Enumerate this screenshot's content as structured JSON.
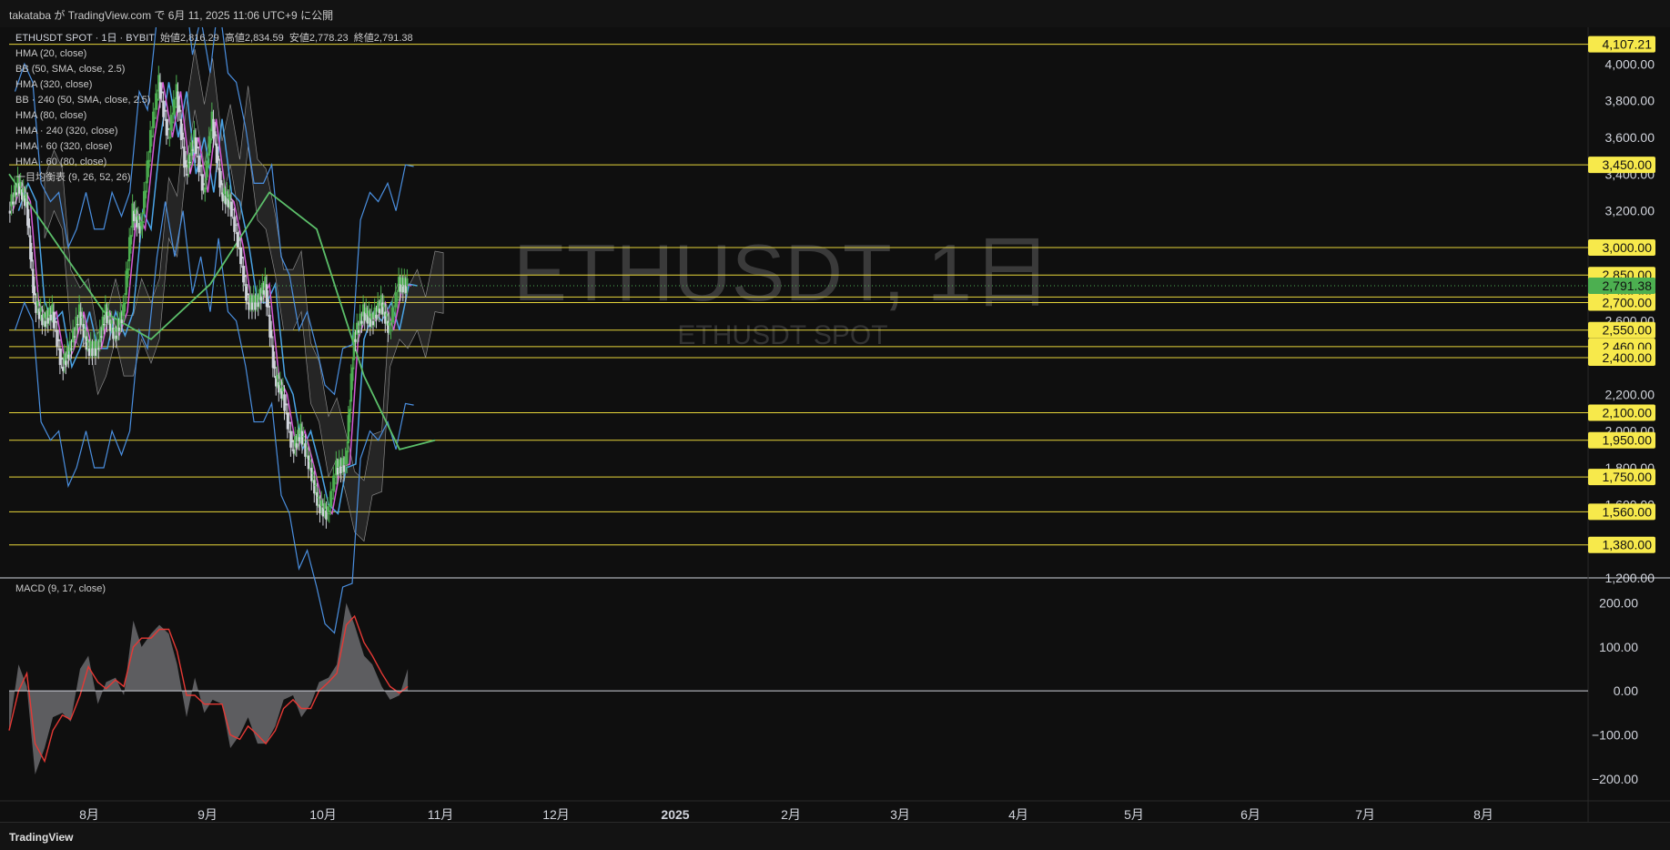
{
  "header": {
    "published": "takataba が TradingView.com で 6月 11, 2025 11:06 UTC+9 に公開"
  },
  "symbol": {
    "title": "ETHUSDT SPOT · 1日 · BYBIT",
    "open_label": "始値",
    "open": "2,816.29",
    "high_label": "高値",
    "high": "2,834.59",
    "low_label": "安値",
    "low": "2,778.23",
    "close_label": "終値",
    "close": "2,791.38"
  },
  "indicators": [
    "HMA (20, close)",
    "BB (50, SMA, close, 2.5)",
    "HMA (320, close)",
    "BB · 240 (50, SMA, close, 2.5)",
    "HMA (80, close)",
    "HMA · 240 (320, close)",
    "HMA · 60 (320, close)",
    "HMA · 60 (80, close)",
    "一目均衡表 (9, 26, 52, 26)"
  ],
  "watermark": {
    "main": "ETHUSDT, 1日",
    "sub": "ETHUSDT SPOT"
  },
  "macd_label": "MACD (9, 17, close)",
  "footer": {
    "brand": "TradingView"
  },
  "colors": {
    "background": "#0f0f0f",
    "candle_up": "#4caf50",
    "candle_down": "#d1d4dc",
    "hline": "#e7d63a",
    "tag_bg": "#f7e94b",
    "current_tag_bg": "#4caf50",
    "bb": "#4a8fe0",
    "hma20": "#d75bd8",
    "hma_blue": "#4aa3e6",
    "hma_green": "#5cbf6a",
    "macd_line": "#e53935",
    "macd_area": "#6b6b6e"
  },
  "chart_data": [
    {
      "type": "line",
      "title": "ETHUSDT SPOT · 1日 · BYBIT",
      "ylim": [
        1200,
        4150
      ],
      "y_ticks": [
        "4,000.00",
        "3,800.00",
        "3,600.00",
        "3,400.00",
        "3,200.00",
        "3,000.00",
        "2,800.00",
        "2,600.00",
        "2,400.00",
        "2,200.00",
        "2,000.00",
        "1,800.00",
        "1,600.00",
        "1,400.00",
        "1,200.00"
      ],
      "x_ticks": [
        "8月",
        "9月",
        "10月",
        "11月",
        "12月",
        "2025",
        "2月",
        "3月",
        "4月",
        "5月",
        "6月",
        "7月",
        "8月"
      ],
      "current_price": 2791.38,
      "current_price_label": "2,791.38",
      "horizontal_levels": [
        4107.21,
        3450,
        3000,
        2850,
        2730,
        2700,
        2550,
        2460,
        2400,
        2100,
        1950,
        1750,
        1560,
        1380
      ],
      "horizontal_level_labels": [
        "4,107.21",
        "3,450.00",
        "3,000.00",
        "2,850.00",
        "2,730.00",
        "2,700.00",
        "2,550.00",
        "2,460.00",
        "2,400.00",
        "2,100.00",
        "1,950.00",
        "1,750.00",
        "1,560.00",
        "1,380.00"
      ],
      "series": [
        {
          "name": "ETHUSDT close",
          "x_day": [
            0,
            8,
            15,
            22,
            30,
            37,
            45,
            52,
            60,
            67,
            75,
            82,
            90,
            97,
            105,
            112,
            120,
            127,
            135,
            142,
            150,
            157,
            165,
            172,
            180,
            187,
            195,
            202,
            210,
            217,
            225,
            232,
            240,
            247,
            255,
            262,
            270,
            277,
            285,
            292,
            300,
            307,
            315,
            322,
            330,
            337,
            345,
            352,
            360,
            367,
            375,
            382
          ],
          "values": [
            3200,
            3350,
            3250,
            2700,
            2600,
            2650,
            2350,
            2450,
            2650,
            2450,
            2450,
            2650,
            2520,
            2650,
            3200,
            3100,
            3600,
            3900,
            3600,
            3850,
            3400,
            3600,
            3300,
            3700,
            3300,
            3250,
            3000,
            2700,
            2700,
            2800,
            2300,
            2200,
            1900,
            2000,
            1800,
            1600,
            1550,
            1800,
            1820,
            2500,
            2650,
            2600,
            2700,
            2550,
            2800,
            2791.38,
            null,
            null,
            null,
            null,
            null,
            null
          ]
        }
      ]
    },
    {
      "type": "area",
      "title": "MACD (9, 17, close)",
      "ylim": [
        -250,
        230
      ],
      "y_ticks": [
        "200.00",
        "100.00",
        "0.00",
        "−100.00",
        "−200.00"
      ],
      "series": [
        {
          "name": "MACD",
          "x_day": [
            0,
            8,
            15,
            22,
            30,
            37,
            45,
            52,
            60,
            67,
            75,
            82,
            90,
            97,
            105,
            112,
            120,
            127,
            135,
            142,
            150,
            157,
            165,
            172,
            180,
            187,
            195,
            202,
            210,
            217,
            225,
            232,
            240,
            247,
            255,
            262,
            270,
            277,
            285,
            292,
            300,
            307,
            315,
            322,
            330,
            337
          ],
          "values": [
            -90,
            60,
            10,
            -190,
            -130,
            -60,
            -50,
            -70,
            50,
            80,
            -30,
            20,
            30,
            -10,
            160,
            100,
            130,
            150,
            130,
            60,
            -60,
            30,
            -50,
            -20,
            -30,
            -130,
            -100,
            -60,
            -120,
            -120,
            -80,
            -20,
            -10,
            -60,
            -30,
            20,
            30,
            60,
            200,
            150,
            80,
            60,
            10,
            -20,
            -10,
            50
          ]
        },
        {
          "name": "Signal",
          "x_day": [
            0,
            8,
            15,
            22,
            30,
            37,
            45,
            52,
            60,
            67,
            75,
            82,
            90,
            97,
            105,
            112,
            120,
            127,
            135,
            142,
            150,
            157,
            165,
            172,
            180,
            187,
            195,
            202,
            210,
            217,
            225,
            232,
            240,
            247,
            255,
            262,
            270,
            277,
            285,
            292,
            300,
            307,
            315,
            322,
            330,
            337
          ],
          "values": [
            -90,
            0,
            40,
            -120,
            -160,
            -90,
            -55,
            -65,
            -10,
            55,
            20,
            5,
            25,
            10,
            100,
            120,
            120,
            140,
            140,
            90,
            -10,
            -10,
            -30,
            -30,
            -30,
            -100,
            -110,
            -80,
            -100,
            -120,
            -90,
            -40,
            -20,
            -40,
            -40,
            0,
            20,
            40,
            150,
            170,
            110,
            80,
            40,
            10,
            -5,
            10
          ]
        }
      ]
    }
  ]
}
